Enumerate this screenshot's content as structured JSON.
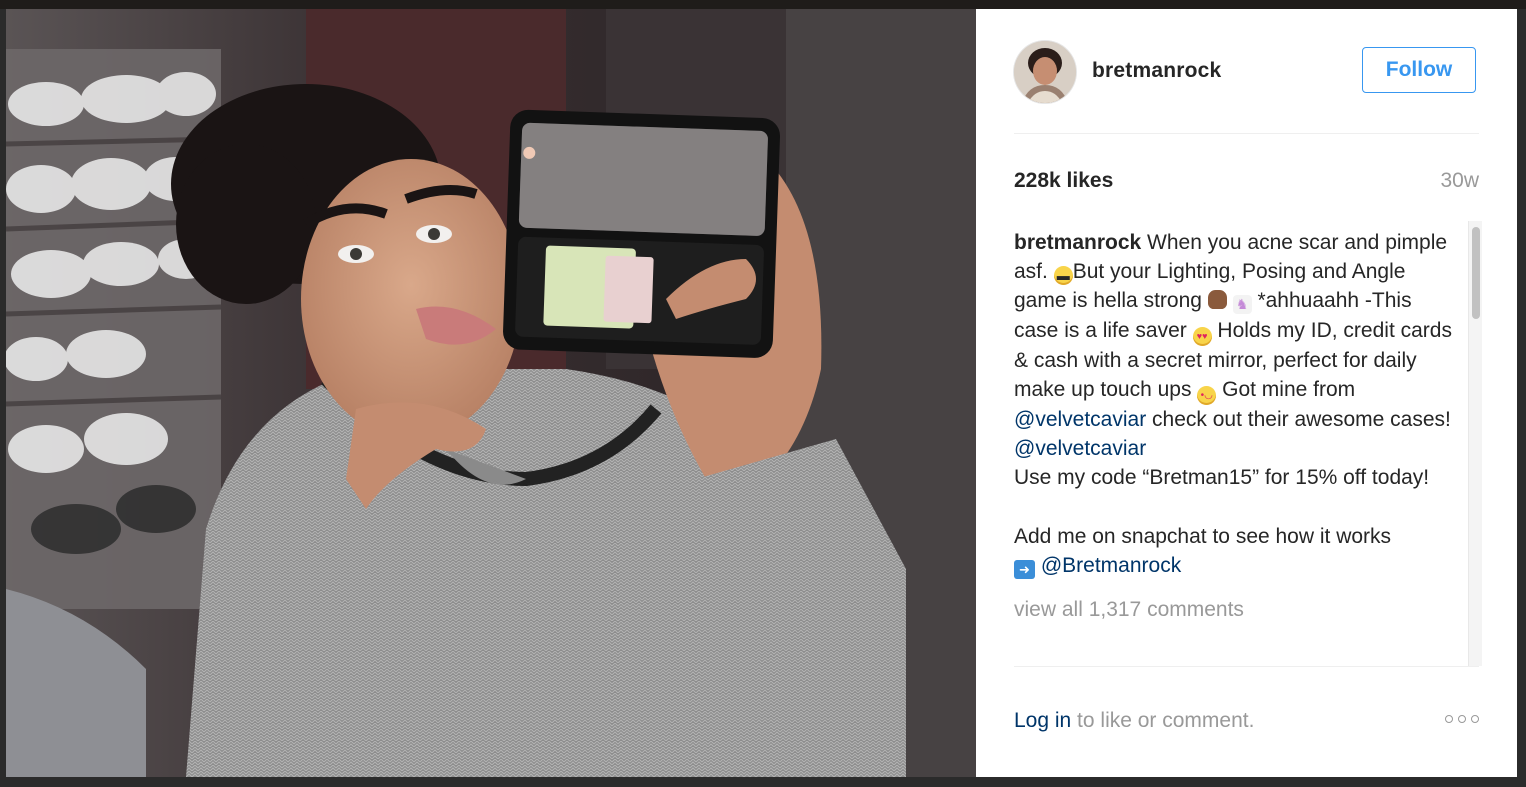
{
  "post": {
    "username": "bretmanrock",
    "follow_label": "Follow",
    "likes": "228k likes",
    "age": "30w",
    "caption": {
      "user": "bretmanrock",
      "line1": " When you acne scar and pimple asf. ",
      "line2": "But your Lighting, Posing and Angle game is hella strong ",
      "line3": " *ahhuaahh -This case is a life saver ",
      "line4": " Holds my ID, credit cards & cash with a secret mirror, perfect for daily make up touch ups ",
      "line5": " Got mine from ",
      "mention1": "@velvetcaviar",
      "line6": " check out their awesome cases! ",
      "mention2": "@velvetcaviar",
      "line7": "Use my code “Bretman15” for 15% off today!",
      "line8": "Add me on snapchat to see how it works",
      "mention3": "@Bretmanrock"
    },
    "view_comments": "view all 1,317 comments",
    "login_link": "Log in",
    "login_rest": " to like or comment."
  },
  "icons": {
    "more": "more-options-icon",
    "emoji_grin": "grinning-emoji-icon",
    "emoji_girl": "girl-emoji-icon",
    "emoji_unicorn": "unicorn-emoji-icon",
    "emoji_heart_eyes": "heart-eyes-emoji-icon",
    "emoji_silly": "silly-face-emoji-icon",
    "emoji_arrow": "right-arrow-emoji-icon"
  },
  "colors": {
    "accent": "#3897f0",
    "mention": "#003569",
    "text": "#262626",
    "muted": "#999999"
  }
}
